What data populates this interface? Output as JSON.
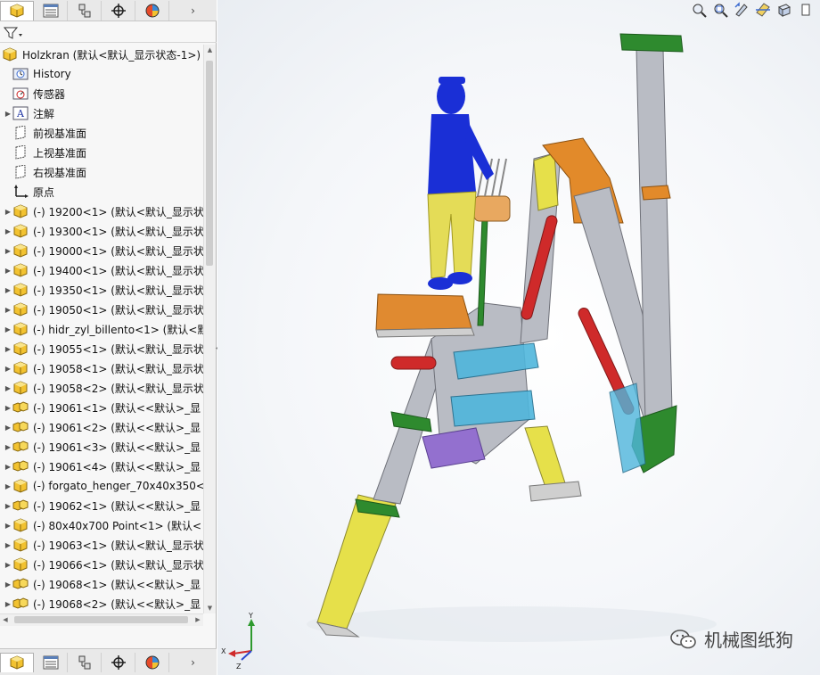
{
  "tree": {
    "root": {
      "label": "Holzkran (默认<默认_显示状态-1>)"
    },
    "items": [
      {
        "label": "History",
        "icon": "history-icon",
        "arrow": false
      },
      {
        "label": "传感器",
        "icon": "sensor-icon",
        "arrow": false
      },
      {
        "label": "注解",
        "icon": "annotation-icon",
        "arrow": true
      },
      {
        "label": "前视基准面",
        "icon": "plane-icon",
        "arrow": false
      },
      {
        "label": "上视基准面",
        "icon": "plane-icon",
        "arrow": false
      },
      {
        "label": "右视基准面",
        "icon": "plane-icon",
        "arrow": false
      },
      {
        "label": "原点",
        "icon": "origin-icon",
        "arrow": false
      },
      {
        "label": "(-) 19200<1> (默认<默认_显示状",
        "icon": "part-icon",
        "arrow": true
      },
      {
        "label": "(-) 19300<1> (默认<默认_显示状",
        "icon": "part-icon",
        "arrow": true
      },
      {
        "label": "(-) 19000<1> (默认<默认_显示状",
        "icon": "part-icon",
        "arrow": true
      },
      {
        "label": "(-) 19400<1> (默认<默认_显示状",
        "icon": "part-icon",
        "arrow": true
      },
      {
        "label": "(-) 19350<1> (默认<默认_显示状",
        "icon": "part-icon",
        "arrow": true
      },
      {
        "label": "(-) 19050<1> (默认<默认_显示状",
        "icon": "part-icon",
        "arrow": true
      },
      {
        "label": "(-) hidr_zyl_billento<1> (默认<默",
        "icon": "part-icon",
        "arrow": true
      },
      {
        "label": "(-) 19055<1> (默认<默认_显示状",
        "icon": "part-icon",
        "arrow": true
      },
      {
        "label": "(-) 19058<1> (默认<默认_显示状",
        "icon": "part-icon",
        "arrow": true
      },
      {
        "label": "(-) 19058<2> (默认<默认_显示状",
        "icon": "part-icon",
        "arrow": true
      },
      {
        "label": "(-) 19061<1> (默认<<默认>_显",
        "icon": "assembly-icon",
        "arrow": true
      },
      {
        "label": "(-) 19061<2> (默认<<默认>_显",
        "icon": "assembly-icon",
        "arrow": true
      },
      {
        "label": "(-) 19061<3> (默认<<默认>_显",
        "icon": "assembly-icon",
        "arrow": true
      },
      {
        "label": "(-) 19061<4> (默认<<默认>_显",
        "icon": "assembly-icon",
        "arrow": true
      },
      {
        "label": "(-) forgato_henger_70x40x350<",
        "icon": "part-icon",
        "arrow": true
      },
      {
        "label": "(-) 19062<1> (默认<<默认>_显",
        "icon": "assembly-icon",
        "arrow": true
      },
      {
        "label": "(-) 80x40x700 Point<1> (默认<",
        "icon": "part-icon",
        "arrow": true
      },
      {
        "label": "(-) 19063<1> (默认<默认_显示状",
        "icon": "part-icon",
        "arrow": true
      },
      {
        "label": "(-) 19066<1> (默认<默认_显示状",
        "icon": "part-icon",
        "arrow": true
      },
      {
        "label": "(-) 19068<1> (默认<<默认>_显",
        "icon": "assembly-icon",
        "arrow": true
      },
      {
        "label": "(-) 19068<2> (默认<<默认>_显",
        "icon": "assembly-icon",
        "arrow": true
      }
    ]
  },
  "triad": {
    "x": "X",
    "y": "Y",
    "z": "Z"
  },
  "watermark": {
    "text": "机械图纸狗"
  },
  "colors": {
    "man": "#1a2fd6",
    "pants": "#e4dc57",
    "frame": "#b9bcc4",
    "yellow": "#e6e04a",
    "orange": "#e28a2a",
    "red": "#cf2a2a",
    "green": "#2e8a2e",
    "cyan": "#4fb6dc",
    "purple": "#9370cf"
  }
}
